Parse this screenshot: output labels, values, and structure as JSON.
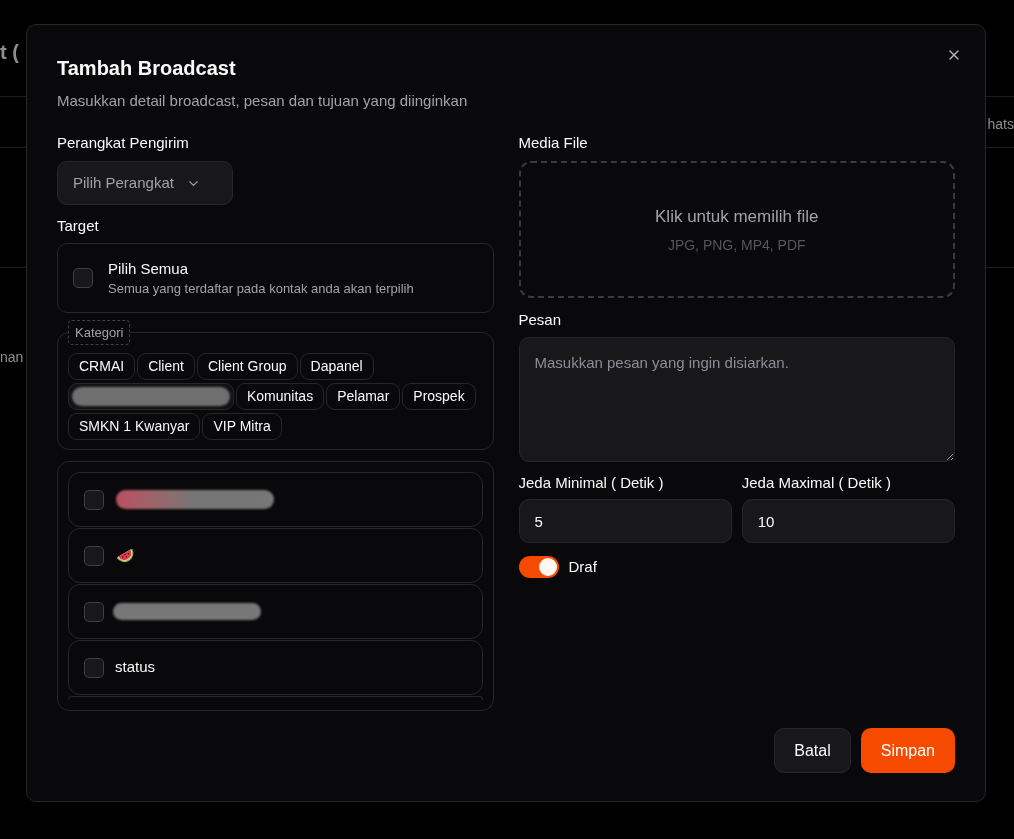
{
  "background_page": {
    "heading_fragment": "t (",
    "column_fragment": "hats",
    "row_fragment": "nan"
  },
  "dialog": {
    "title": "Tambah Broadcast",
    "description": "Masukkan detail broadcast, pesan dan tujuan yang diinginkan"
  },
  "sender_device": {
    "label": "Perangkat Pengirim",
    "placeholder": "Pilih Perangkat"
  },
  "target": {
    "label": "Target",
    "select_all": {
      "title": "Pilih Semua",
      "description": "Semua yang terdaftar pada kontak anda akan terpilih",
      "checked": false
    },
    "categories": {
      "legend": "Kategori",
      "chips": [
        {
          "kind": "text",
          "label": "CRMAI"
        },
        {
          "kind": "text",
          "label": "Client"
        },
        {
          "kind": "text",
          "label": "Client Group"
        },
        {
          "kind": "text",
          "label": "Dapanel"
        },
        {
          "kind": "redacted"
        },
        {
          "kind": "text",
          "label": "Komunitas"
        },
        {
          "kind": "text",
          "label": "Pelamar"
        },
        {
          "kind": "text",
          "label": "Prospek"
        },
        {
          "kind": "text",
          "label": "SMKN 1 Kwanyar"
        },
        {
          "kind": "text",
          "label": "VIP Mitra"
        }
      ]
    },
    "contacts": [
      {
        "kind": "redacted_emoji",
        "checked": false
      },
      {
        "kind": "emoji",
        "checked": false
      },
      {
        "kind": "redacted",
        "checked": false
      },
      {
        "kind": "text",
        "label": "status",
        "checked": false
      },
      {
        "kind": "partial"
      }
    ]
  },
  "media_file": {
    "label": "Media File",
    "prompt": "Klik untuk memilih file",
    "formats": "JPG, PNG, MP4, PDF"
  },
  "message": {
    "label": "Pesan",
    "placeholder": "Masukkan pesan yang ingin disiarkan."
  },
  "delay_min": {
    "label": "Jeda Minimal ( Detik )",
    "value": "5"
  },
  "delay_max": {
    "label": "Jeda Maximal ( Detik )",
    "value": "10"
  },
  "draft": {
    "label": "Draf",
    "on": true
  },
  "buttons": [
    {
      "kind": "secondary",
      "label": "Batal"
    },
    {
      "kind": "primary",
      "label": "Simpan"
    }
  ]
}
